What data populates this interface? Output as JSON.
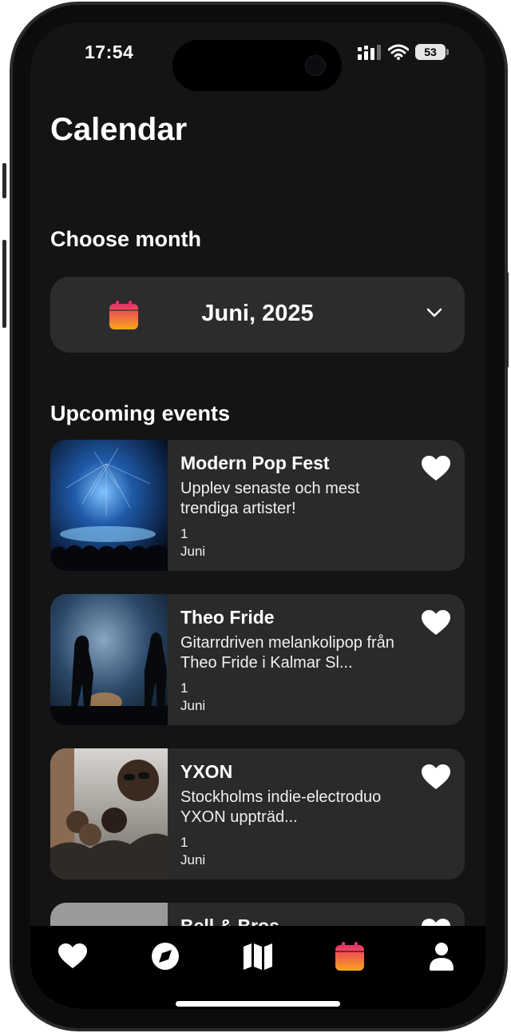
{
  "status_bar": {
    "time": "17:54",
    "battery": "53"
  },
  "page": {
    "title": "Calendar"
  },
  "month_picker": {
    "heading": "Choose month",
    "value": "Juni, 2025",
    "icon": "calendar-icon"
  },
  "events": {
    "heading": "Upcoming events",
    "items": [
      {
        "name": "Modern Pop Fest",
        "description": "Upplev senaste och mest trendiga artister!",
        "day": "1",
        "month": "Juni",
        "favorite": true
      },
      {
        "name": "Theo Fride",
        "description": "Gitarrdriven melankolipop från Theo Fride i Kalmar Sl...",
        "day": "1",
        "month": "Juni",
        "favorite": true
      },
      {
        "name": "YXON",
        "description": "Stockholms indie-electroduo YXON uppträd...",
        "day": "1",
        "month": "Juni",
        "favorite": true
      },
      {
        "name": "Bell & Bros",
        "description": "",
        "day": "",
        "month": "",
        "favorite": true
      }
    ]
  },
  "tab_bar": {
    "items": [
      {
        "icon": "heart-icon",
        "active": false
      },
      {
        "icon": "compass-icon",
        "active": false
      },
      {
        "icon": "map-icon",
        "active": false
      },
      {
        "icon": "calendar-icon",
        "active": true
      },
      {
        "icon": "profile-icon",
        "active": false
      }
    ]
  },
  "colors": {
    "background": "#141414",
    "card": "#2a2a2a",
    "accent_gradient": [
      "#e8306a",
      "#f7a51c"
    ]
  }
}
